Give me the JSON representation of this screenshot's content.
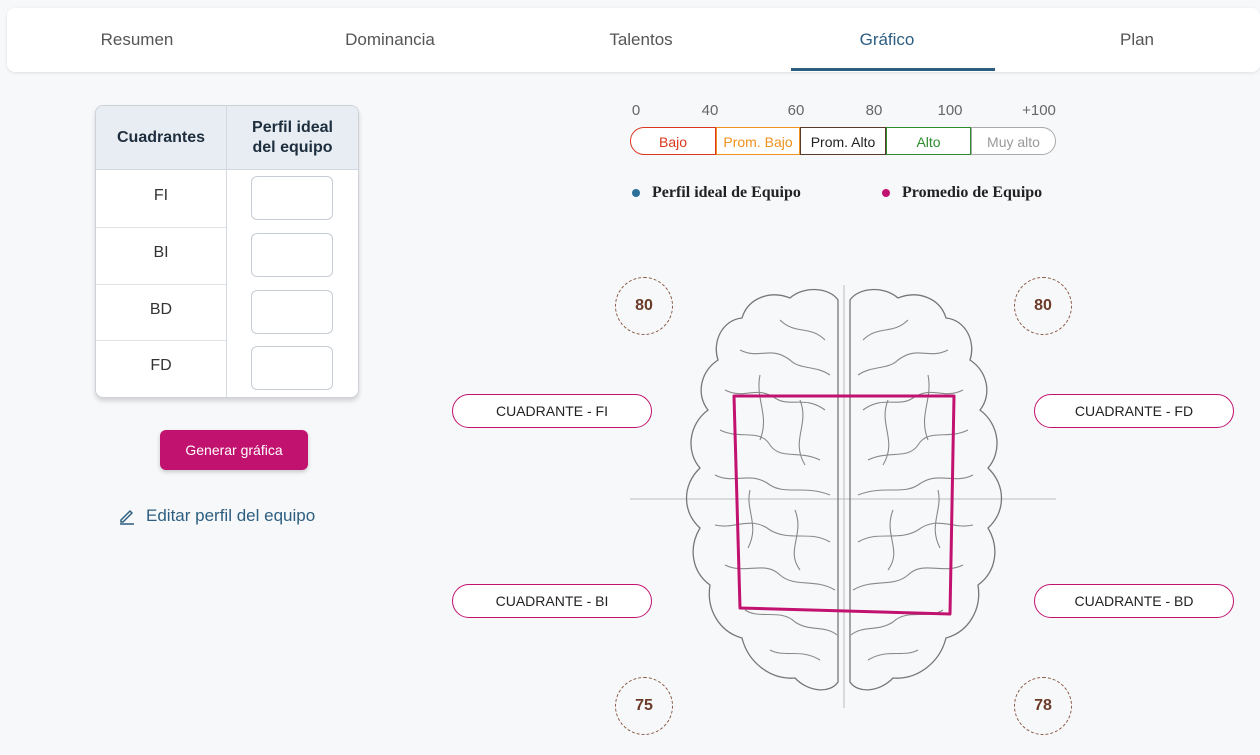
{
  "tabs": [
    {
      "label": "Resumen"
    },
    {
      "label": "Dominancia"
    },
    {
      "label": "Talentos"
    },
    {
      "label": "Gráfico"
    },
    {
      "label": "Plan"
    }
  ],
  "active_tab": "Gráfico",
  "table": {
    "col1": "Cuadrantes",
    "col2_line1": "Perfil ideal",
    "col2_line2": "del equipo",
    "rows": [
      {
        "label": "FI",
        "value": ""
      },
      {
        "label": "BI",
        "value": ""
      },
      {
        "label": "BD",
        "value": ""
      },
      {
        "label": "FD",
        "value": ""
      }
    ]
  },
  "buttons": {
    "generate": "Generar gráfica",
    "edit": "Editar perfil del equipo"
  },
  "scale": {
    "ticks": [
      "0",
      "40",
      "60",
      "80",
      "100",
      "+100"
    ],
    "segments": [
      {
        "label": "Bajo",
        "color": "#d9381e"
      },
      {
        "label": "Prom. Bajo",
        "color": "#f0901e"
      },
      {
        "label": "Prom. Alto",
        "color": "#5a3a2a"
      },
      {
        "label": "Alto",
        "color": "#2e8b2e"
      },
      {
        "label": "Muy alto",
        "color": "#999999"
      }
    ]
  },
  "legend": [
    {
      "label": "Perfil ideal de Equipo",
      "color": "#2b6f9a"
    },
    {
      "label": "Promedio de Equipo",
      "color": "#c2126f"
    }
  ],
  "quadrants": {
    "fi": {
      "label": "CUADRANTE - FI",
      "score": "80"
    },
    "fd": {
      "label": "CUADRANTE - FD",
      "score": "80"
    },
    "bi": {
      "label": "CUADRANTE - BI",
      "score": "75"
    },
    "bd": {
      "label": "CUADRANTE - BD",
      "score": "78"
    }
  },
  "colors": {
    "accent": "#c2126f",
    "primary": "#2d5e80"
  }
}
